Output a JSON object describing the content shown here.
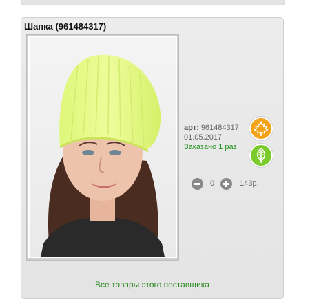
{
  "product": {
    "title": "Шапка (961484317)",
    "art_label": "арт:",
    "art_number": "961484317",
    "date": "01.05.2017",
    "ordered_text": "Заказано 1 раз",
    "dot": ","
  },
  "quantity": {
    "value": "0",
    "price": "143р."
  },
  "footer": {
    "supplier_link": "Все товары этого поставщика"
  },
  "icons": {
    "maple_badge": "maple-leaf-icon",
    "eco_badge": "leaf-icon",
    "minus": "minus-icon",
    "plus": "plus-icon"
  },
  "colors": {
    "maple_badge": "#f2a31a",
    "eco_badge": "#7ccb2c",
    "ordered_text": "#22911c",
    "link": "#2b8a1f"
  }
}
